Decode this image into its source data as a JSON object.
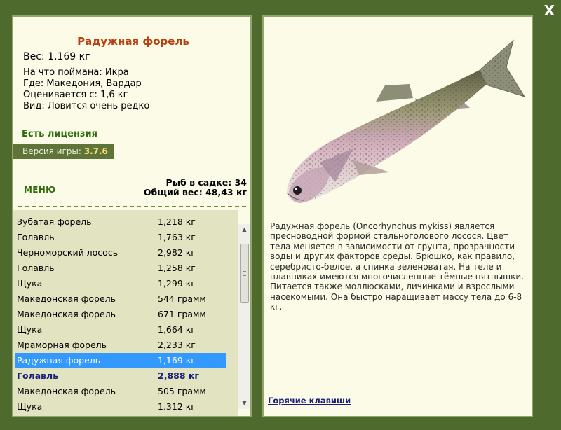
{
  "close_label": "X",
  "fish": {
    "title": "Радужная форель",
    "weight": "Вес: 1,169 кг",
    "caught_on": "На что поймана: Икра",
    "location": "Где: Македония, Вардар",
    "rated_from": "Оценивается с: 1,6 кг",
    "rarity": "Вид: Ловится очень редко",
    "description": "Радужная форель (Oncorhynchus mykiss) является пресноводной формой стальноголового лосося. Цвет тела меняется в зависимости от грунта, прозрачности воды и других факторов среды. Брюшко, как правило, серебристо-белое, а спинка зеленоватая. На теле и плавниках имеются многочисленные тёмные пятнышки. Питается также моллюсками, личинками и взрослыми насекомыми. Она быстро наращивает массу тела до 6-8 кг."
  },
  "license": "Есть лицензия",
  "version": {
    "label": "Версия игры:",
    "value": "3.7.6"
  },
  "menu_label": "МЕНЮ",
  "keep": {
    "count": "Рыб в садке: 34",
    "total": "Общий вес: 48,43 кг"
  },
  "catch_list": [
    {
      "name": "Зубатая форель",
      "weight": "1,218 кг"
    },
    {
      "name": "Голавль",
      "weight": "1,763 кг"
    },
    {
      "name": "Черноморский лосось",
      "weight": "2,982 кг"
    },
    {
      "name": "Голавль",
      "weight": "1,258 кг"
    },
    {
      "name": "Щука",
      "weight": "1,299 кг"
    },
    {
      "name": "Македонская форель",
      "weight": "544 грамм"
    },
    {
      "name": "Македонская форель",
      "weight": "671 грамм"
    },
    {
      "name": "Щука",
      "weight": "1,664 кг"
    },
    {
      "name": "Мраморная форель",
      "weight": "2,233 кг"
    },
    {
      "name": "Радужная форель",
      "weight": "1,169 кг"
    },
    {
      "name": "Голавль",
      "weight": "2,888 кг"
    },
    {
      "name": "Македонская форель",
      "weight": "505 грамм"
    },
    {
      "name": "Щука",
      "weight": "1.312 кг"
    }
  ],
  "hotkeys_label": "Горячие клавиши",
  "colors": {
    "background": "#4e6a2c",
    "panel": "#fbfbe8",
    "title": "#b7400f",
    "selection": "#3399ff"
  }
}
